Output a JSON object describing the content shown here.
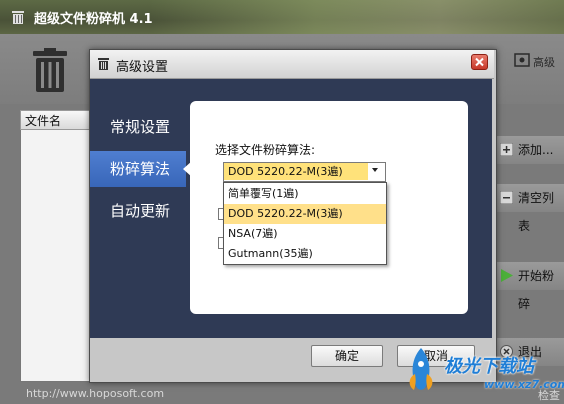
{
  "main_window": {
    "title": "超级文件粉碎机 4.1",
    "toolbar_right_label": "高级",
    "file_list_header": "文件名",
    "side_buttons": [
      "添加...",
      "清空列表",
      "开始粉碎",
      "退出"
    ],
    "status_url": "http://www.hoposoft.com",
    "check_label": "检查"
  },
  "dialog": {
    "title": "高级设置",
    "nav": [
      "常规设置",
      "粉碎算法",
      "自动更新"
    ],
    "selected_nav": "粉碎算法",
    "algorithm_label": "选择文件粉碎算法:",
    "algorithm_selected": "DOD 5220.22-M(3遍)",
    "algorithm_options": [
      "简单覆写(1遍)",
      "DOD 5220.22-M(3遍)",
      "NSA(7遍)",
      "Gutmann(35遍)"
    ],
    "ok_label": "确定",
    "cancel_label": "取消"
  },
  "watermark": {
    "text": "极光下载站",
    "url": "www.xz7.com"
  },
  "colors": {
    "nav_selected": "#3f6fc4",
    "dialog_body": "#2f3a55",
    "dropdown_highlight": "#ffe08a"
  }
}
